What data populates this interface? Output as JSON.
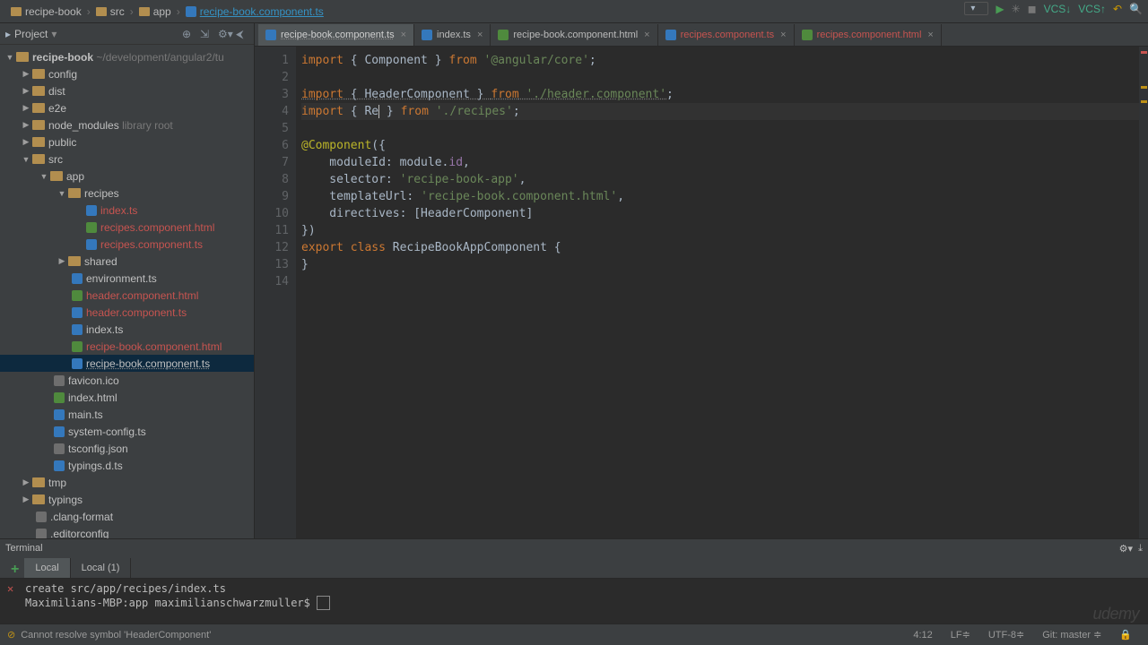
{
  "breadcrumb": {
    "i0": "recipe-book",
    "i1": "src",
    "i2": "app",
    "i3": "recipe-book.component.ts"
  },
  "projectPanel": {
    "title": "Project"
  },
  "tree": {
    "root": "recipe-book",
    "rootpath": "~/development/angular2/tu",
    "config": "config",
    "dist": "dist",
    "e2e": "e2e",
    "node_modules": "node_modules",
    "libroot": "library root",
    "public": "public",
    "src": "src",
    "app": "app",
    "recipes": "recipes",
    "indexts": "index.ts",
    "recipeshtml": "recipes.component.html",
    "recipests": "recipes.component.ts",
    "shared": "shared",
    "envts": "environment.ts",
    "headerhtml": "header.component.html",
    "headerts": "header.component.ts",
    "indexts2": "index.ts",
    "rbhtml": "recipe-book.component.html",
    "rbts": "recipe-book.component.ts",
    "favicon": "favicon.ico",
    "indexhtml": "index.html",
    "maints": "main.ts",
    "sysconfig": "system-config.ts",
    "tsconfig": "tsconfig.json",
    "typingsd": "typings.d.ts",
    "tmp": "tmp",
    "typings": "typings",
    "clang": ".clang-format",
    "editorconfig": ".editorconfig"
  },
  "tabs": {
    "t0": "recipe-book.component.ts",
    "t1": "index.ts",
    "t2": "recipe-book.component.html",
    "t3": "recipes.component.ts",
    "t4": "recipes.component.html"
  },
  "code": {
    "l1a": "import",
    "l1b": " { Component } ",
    "l1c": "from",
    "l1d": " '@angular/core'",
    "l1e": ";",
    "l3a": "import",
    "l3b": " { HeaderComponent } ",
    "l3c": "from",
    "l3d": " './header.component'",
    "l3e": ";",
    "l4a": "import",
    "l4b": " { ",
    "l4c": "Re",
    "l4d": " } ",
    "l4e": "from",
    "l4f": " './recipes'",
    "l4g": ";",
    "l6a": "@Component",
    "l6b": "({",
    "l7a": "    moduleId: module.",
    "l7b": "id",
    "l7c": ",",
    "l8a": "    selector: ",
    "l8b": "'recipe-book-app'",
    "l8c": ",",
    "l9a": "    templateUrl: ",
    "l9b": "'recipe-book.component.html'",
    "l9c": ",",
    "l10a": "    directives: [HeaderComponent]",
    "l11": "})",
    "l12a": "export class",
    "l12b": " RecipeBookAppComponent {",
    "l13": "}"
  },
  "gutter": {
    "n1": "1",
    "n2": "2",
    "n3": "3",
    "n4": "4",
    "n5": "5",
    "n6": "6",
    "n7": "7",
    "n8": "8",
    "n9": "9",
    "n10": "10",
    "n11": "11",
    "n12": "12",
    "n13": "13",
    "n14": "14"
  },
  "terminal": {
    "title": "Terminal",
    "tab0": "Local",
    "tab1": "Local (1)",
    "line1": "  create src/app/recipes/index.ts",
    "line2": "Maximilians-MBP:app maximilianschwarzmuller$ "
  },
  "status": {
    "msg": "Cannot resolve symbol 'HeaderComponent'",
    "pos": "4:12",
    "lf": "LF≑",
    "enc": "UTF-8≑",
    "git": "Git: master ≑"
  },
  "watermark": "udemy"
}
